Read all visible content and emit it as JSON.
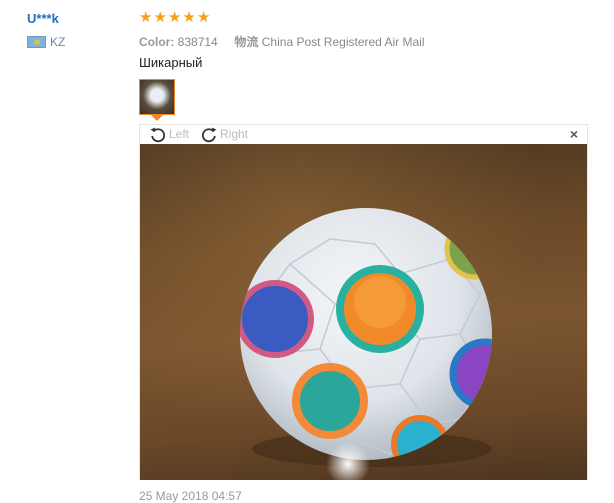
{
  "review": {
    "user_name": "U***k",
    "country_code": "KZ",
    "rating_stars": 5,
    "color_label": "Color:",
    "color_value": "838714",
    "shipping_label": "物流",
    "shipping_value": "China Post Registered Air Mail",
    "text": "Шикарный",
    "date": "25 May 2018 04:57"
  },
  "viewer": {
    "rotate_left_label": "Left",
    "rotate_right_label": "Right",
    "close_label": "×"
  },
  "colors": {
    "accent": "#f0872a",
    "user_link": "#2a6ec0",
    "star": "#f7a01d"
  },
  "icons": [
    "flag-icon",
    "star-icon",
    "rotate-left-icon",
    "rotate-right-icon",
    "close-icon"
  ]
}
